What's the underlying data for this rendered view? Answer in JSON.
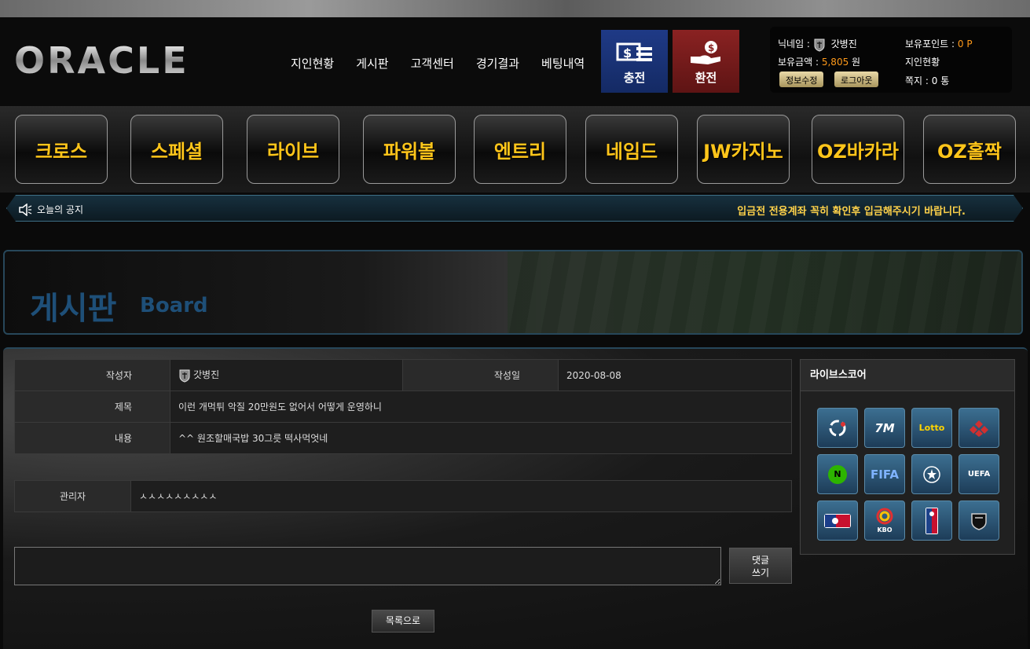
{
  "logo": "ORACLE",
  "nav": [
    "지인현황",
    "게시판",
    "고객센터",
    "경기결과",
    "베팅내역"
  ],
  "charge": "충전",
  "exchange": "환전",
  "user": {
    "nick_label": "닉네임 :",
    "nick": "갓병진",
    "points_label": "보유포인트 :",
    "points": "0 P",
    "balance_label": "보유금액 :",
    "balance": "5,805",
    "balance_unit": "원",
    "friends": "지인현황",
    "edit": "정보수정",
    "logout": "로그아웃",
    "notes_label": "쪽지 :",
    "notes": "0 통"
  },
  "games": [
    "크로스",
    "스페셜",
    "라이브",
    "파워볼",
    "엔트리",
    "네임드",
    "JW카지노",
    "OZ바카라",
    "OZ홀짝"
  ],
  "notice": {
    "label": "오늘의 공지",
    "text": "입금전 전용계좌 꼭히 확인후 입금해주시기 바랍니다."
  },
  "banner": {
    "title": "게시판",
    "sub": "Board"
  },
  "post": {
    "author_label": "작성자",
    "author": "갓병진",
    "date_label": "작성일",
    "date": "2020-08-08",
    "subject_label": "제목",
    "subject": "이런 개먹튀 악질 20만원도 없어서 어떻게 운영하니",
    "content_label": "내용",
    "content": "^^ 원조할매국밥 30그릇 떡사먹엇네"
  },
  "admin": {
    "label": "관리자",
    "text": "ㅅㅅㅅㅅㅅㅅㅅㅅㅅ"
  },
  "comment_btn": "댓글\n쓰기",
  "list_btn": "목록으로",
  "livescore": {
    "title": "라이브스코어",
    "icons": [
      "",
      "7M",
      "Lotto",
      "",
      "N",
      "FIFA",
      "",
      "UEFA",
      "",
      "KBO",
      "",
      ""
    ]
  }
}
